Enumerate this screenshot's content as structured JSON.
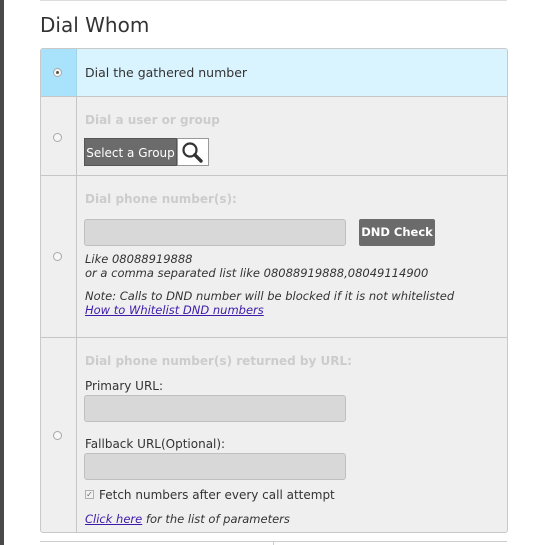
{
  "section_title": "Dial Whom",
  "options": {
    "gathered": {
      "label": "Dial the gathered number",
      "selected": true
    },
    "user_group": {
      "label": "Dial a user or group",
      "select_button": "Select a Group",
      "search_icon": "search-icon"
    },
    "phone_numbers": {
      "label": "Dial phone number(s):",
      "input_value": "",
      "dnd_button": "DND Check",
      "hint_line1": "Like 08088919888",
      "hint_line2": "or a comma separated list like 08088919888,08049114900",
      "note": "Note: Calls to DND number will be blocked if it is not whitelisted",
      "whitelist_link": "How to Whitelist DND numbers"
    },
    "url": {
      "label": "Dial phone number(s) returned by URL:",
      "primary_label": "Primary URL:",
      "primary_value": "",
      "fallback_label": "Fallback URL(Optional):",
      "fallback_value": "",
      "fetch_label": "Fetch numbers after every call attempt",
      "fetch_checked": true,
      "click_here": "Click here",
      "params_text": " for the list of parameters"
    }
  },
  "colors": {
    "selected_bg": "#d9f3ff",
    "selected_radio_bg": "#a9e2fb",
    "button_bg": "#6b6b6b",
    "link": "#3d1aa8"
  }
}
